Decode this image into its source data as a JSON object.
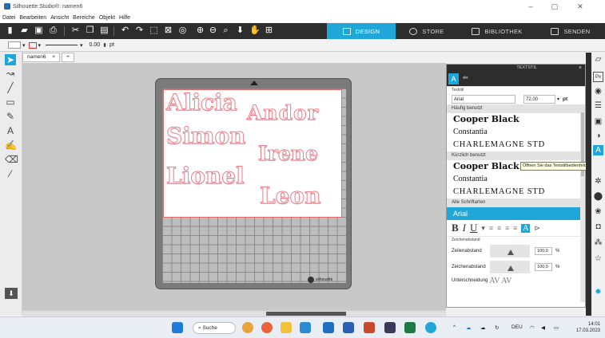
{
  "window": {
    "title": "Silhouette Studio®: namen6",
    "minimize": "–",
    "maximize": "▢",
    "close": "✕"
  },
  "menu": [
    "Datei",
    "Bearbeiten",
    "Ansicht",
    "Bereiche",
    "Objekt",
    "Hilfe"
  ],
  "nav_tabs": [
    "DESIGN",
    "STORE",
    "BIBLIOTHEK",
    "SENDEN"
  ],
  "toolbar2": {
    "line_width": "0.00",
    "unit": "pt"
  },
  "doc_tabs": {
    "current": "namen6",
    "close": "×",
    "add": "+"
  },
  "canvas": {
    "names": [
      "Alicia",
      "Andor",
      "Simon",
      "Irene",
      "Lionel",
      "Leon"
    ],
    "logo": "silhouette"
  },
  "text_style_panel": {
    "title": "TEXTSTIL",
    "section_text": "Textstil",
    "font": "Arial",
    "size": "72,00",
    "size_unit": "pt",
    "often_used_label": "Häufig benutzt",
    "often_used": [
      "Cooper Black",
      "Constantia",
      "CHARLEMAGNE STD"
    ],
    "recent_label": "Kürzlich benutzt",
    "recent": [
      "Cooper Black",
      "Constantia",
      "CHARLEMAGNE STD"
    ],
    "all_fonts_label": "Alle Schriftarten",
    "selected_font": "Arial",
    "spacing_section": "Zeichenabstand",
    "line_spacing_label": "Zeilenabstand",
    "line_spacing_value": "100,0",
    "char_spacing_label": "Zeichenabstand",
    "char_spacing_value": "100,0",
    "percent": "%",
    "kerning_label": "Unterschneidung"
  },
  "tooltip": "Öffnen Sie das Textstilbedienfeld",
  "taskbar": {
    "search": "Suche",
    "language": "DEU",
    "time": "14:01",
    "date": "17.03.2023"
  },
  "colors": {
    "accent": "#1fa7d9",
    "toolbar": "#2d2d2d",
    "name_outline": "#f07a84"
  }
}
